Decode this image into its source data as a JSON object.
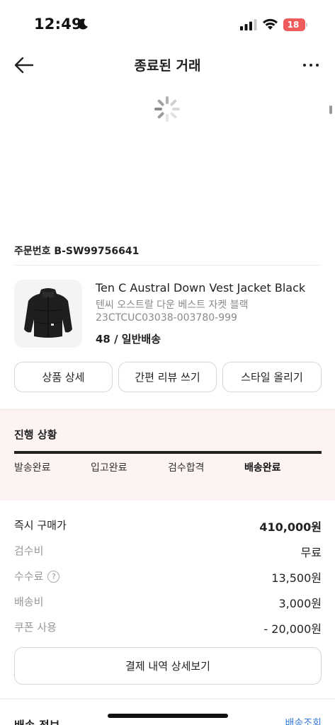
{
  "status_bar": {
    "time": "12:49",
    "battery": "18"
  },
  "header": {
    "title": "종료된 거래",
    "back_icon": "arrow-left-icon",
    "more_icon": "ellipsis-icon"
  },
  "order": {
    "number_label": "주문번호 B-SW99756641"
  },
  "product": {
    "name_en": "Ten C Austral Down Vest Jacket Black",
    "name_ko": "텐씨 오스트랄 다운 베스트 자켓 블랙",
    "code": "23CTCUC03038-003780-999",
    "option": "48 / 일반배송"
  },
  "actions": {
    "detail": "상품 상세",
    "review": "간편 리뷰 쓰기",
    "style": "스타일 올리기"
  },
  "progress": {
    "title": "진행 상황",
    "steps": [
      "발송완료",
      "입고완료",
      "검수합격",
      "배송완료"
    ],
    "current_step_index": 3,
    "fill_fraction": 1.0
  },
  "prices": {
    "buy_now_label": "즉시 구매가",
    "buy_now_value": "410,000원",
    "inspection_label": "검수비",
    "inspection_value": "무료",
    "fee_label": "수수료",
    "fee_help": "?",
    "fee_value": "13,500원",
    "shipping_label": "배송비",
    "shipping_value": "3,000원",
    "coupon_label": "쿠폰 사용",
    "coupon_value": "- 20,000원"
  },
  "payment_detail_button": "결제 내역 상세보기",
  "shipping_info": {
    "title": "배송 정보",
    "track_link": "배송조회"
  },
  "colors": {
    "progress_bg": "#fdf3f3",
    "battery": "#ef5b5b",
    "link": "#3a7bd5"
  }
}
